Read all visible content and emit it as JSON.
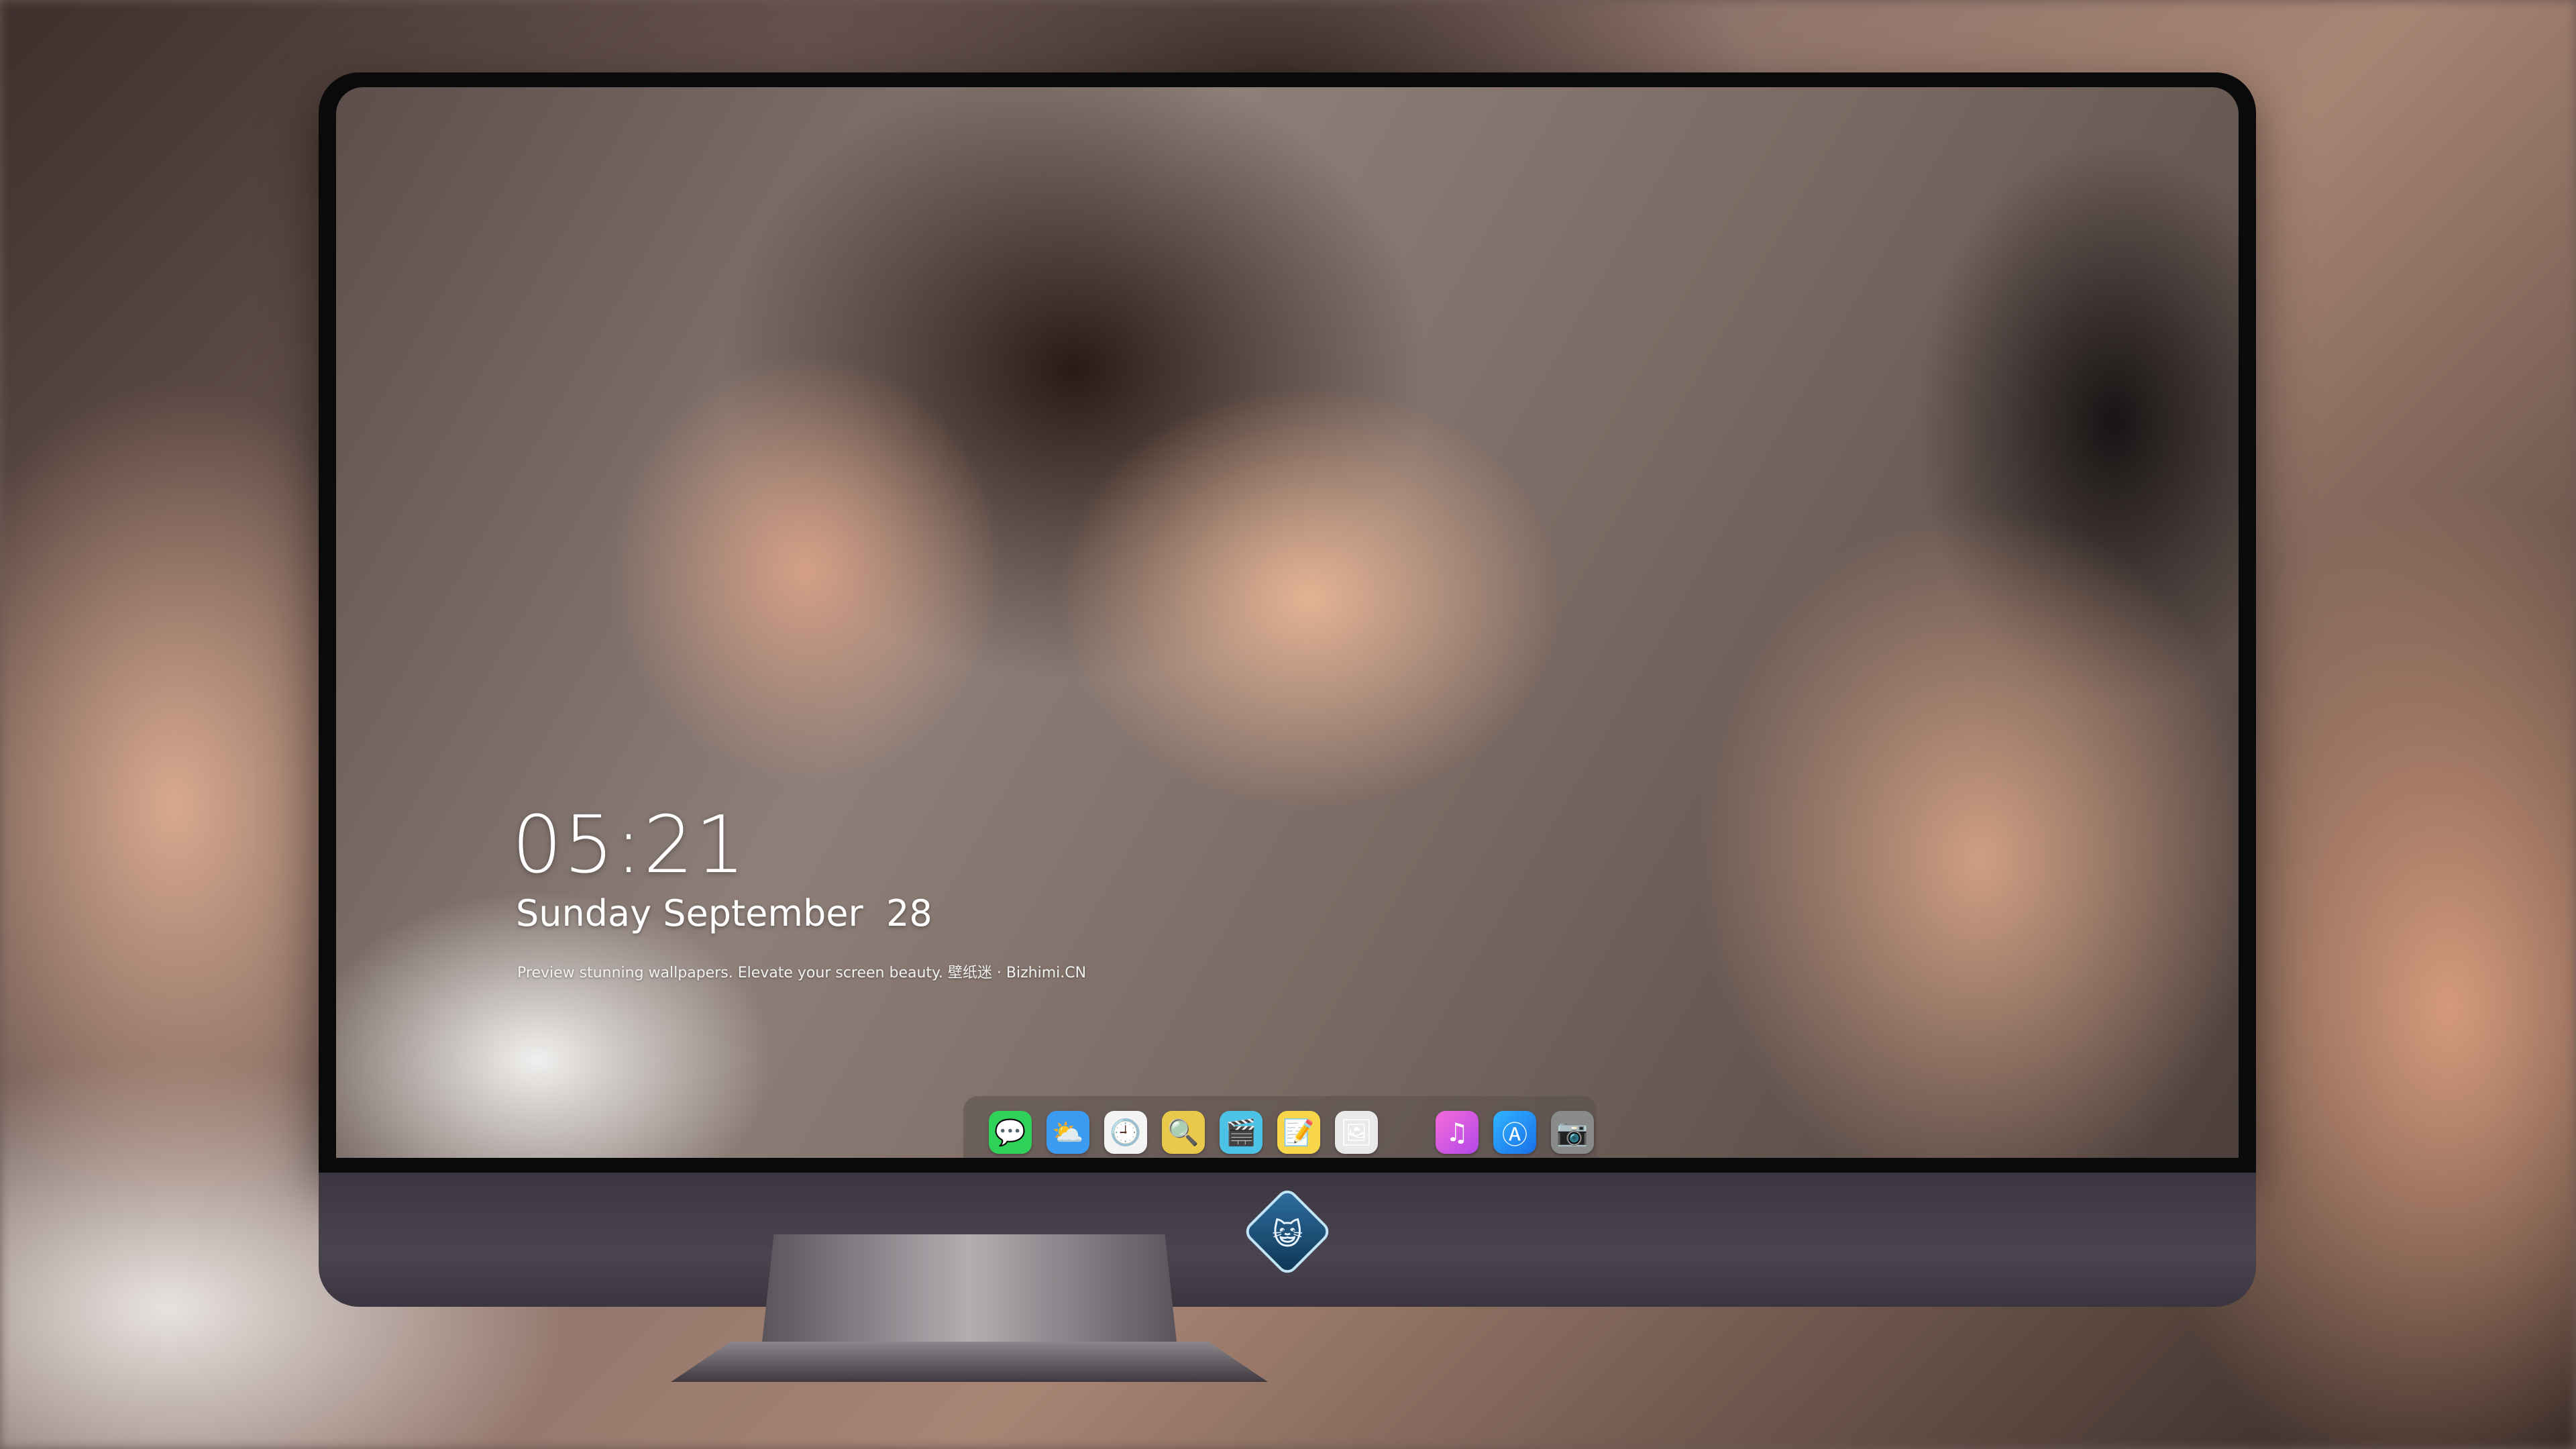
{
  "lockscreen": {
    "time": "05:21",
    "date": "Sunday September  28",
    "tagline": "Preview stunning wallpapers. Elevate your screen beauty. 壁纸迷 · Bizhimi.CN"
  },
  "dock": {
    "items": [
      {
        "name": "messages-icon",
        "glyph": "💬",
        "color": "#2fd158"
      },
      {
        "name": "weather-icon",
        "glyph": "⛅",
        "color": "#3a9bf0"
      },
      {
        "name": "clock-icon",
        "glyph": "🕘",
        "color": "#f4f4f4"
      },
      {
        "name": "preview-icon",
        "glyph": "🔍",
        "color": "#e9c84a"
      },
      {
        "name": "video-editor-icon",
        "glyph": "🎬",
        "color": "#4cc3e6"
      },
      {
        "name": "notes-icon",
        "glyph": "📝",
        "color": "#f7d64c"
      },
      {
        "name": "photo-gallery-icon",
        "glyph": "🖼",
        "color": "#e9e9e9"
      }
    ],
    "pinned": [
      {
        "name": "music-icon",
        "glyph": "♫",
        "color": "#e54bd3"
      },
      {
        "name": "app-store-icon",
        "glyph": "Ⓐ",
        "color": "#1e8ef0"
      },
      {
        "name": "camera-icon",
        "glyph": "📷",
        "color": "#8a8a8a"
      }
    ]
  },
  "brand": {
    "logo": "bizhimi-mascot-icon"
  }
}
